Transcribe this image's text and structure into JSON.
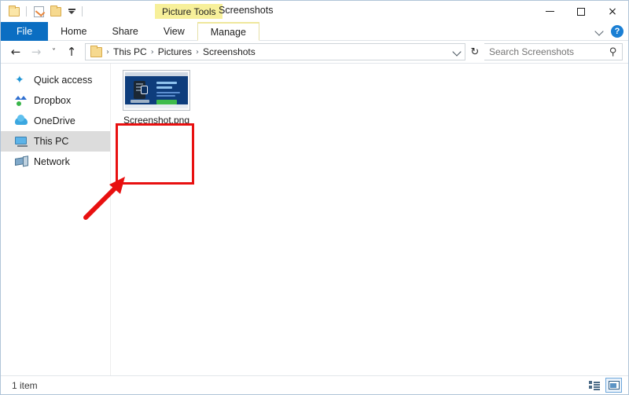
{
  "window": {
    "title": "Screenshots",
    "contextual_tab_title": "Picture Tools",
    "controls": {
      "minimize": "minimize-button",
      "maximize": "maximize-button",
      "close": "×"
    }
  },
  "quick_access_toolbar": {
    "items": [
      {
        "name": "explorer-icon",
        "label": ""
      },
      {
        "name": "properties-icon",
        "label": ""
      },
      {
        "name": "new-folder-icon",
        "label": ""
      },
      {
        "name": "customize-qat-caret",
        "label": ""
      }
    ]
  },
  "ribbon": {
    "tabs": [
      {
        "label": "File",
        "active": false,
        "style": "file"
      },
      {
        "label": "Home",
        "active": false,
        "style": "normal"
      },
      {
        "label": "Share",
        "active": false,
        "style": "normal"
      },
      {
        "label": "View",
        "active": false,
        "style": "normal"
      },
      {
        "label": "Manage",
        "active": true,
        "style": "contextual"
      }
    ],
    "collapse_label": "",
    "help_label": "?"
  },
  "address_bar": {
    "back_label": "←",
    "forward_label": "→",
    "recent_label": "˅",
    "up_label": "↑",
    "breadcrumbs": [
      "This PC",
      "Pictures",
      "Screenshots"
    ],
    "separator": "›",
    "dropdown_label": "",
    "refresh_label": "↻"
  },
  "search": {
    "placeholder": "Search Screenshots",
    "value": "",
    "icon_label": "⚲"
  },
  "navigation_pane": {
    "items": [
      {
        "label": "Quick access",
        "icon": "star-icon",
        "selected": false
      },
      {
        "label": "Dropbox",
        "icon": "dropbox-icon",
        "selected": false
      },
      {
        "label": "OneDrive",
        "icon": "cloud-icon",
        "selected": false
      },
      {
        "label": "This PC",
        "icon": "computer-icon",
        "selected": true
      },
      {
        "label": "Network",
        "icon": "network-icon",
        "selected": false
      }
    ]
  },
  "file_list": {
    "items": [
      {
        "name": "Screenshot.png",
        "type": "png-image",
        "selected": true
      }
    ]
  },
  "annotations": {
    "highlight_box_color": "#e81010",
    "arrow_color": "#e81010",
    "contextual_tab_highlight_color": "#f7f09a"
  },
  "status_bar": {
    "item_count": "1 item",
    "views": [
      {
        "name": "details-view-button",
        "active": false
      },
      {
        "name": "large-icons-view-button",
        "active": true
      }
    ]
  }
}
